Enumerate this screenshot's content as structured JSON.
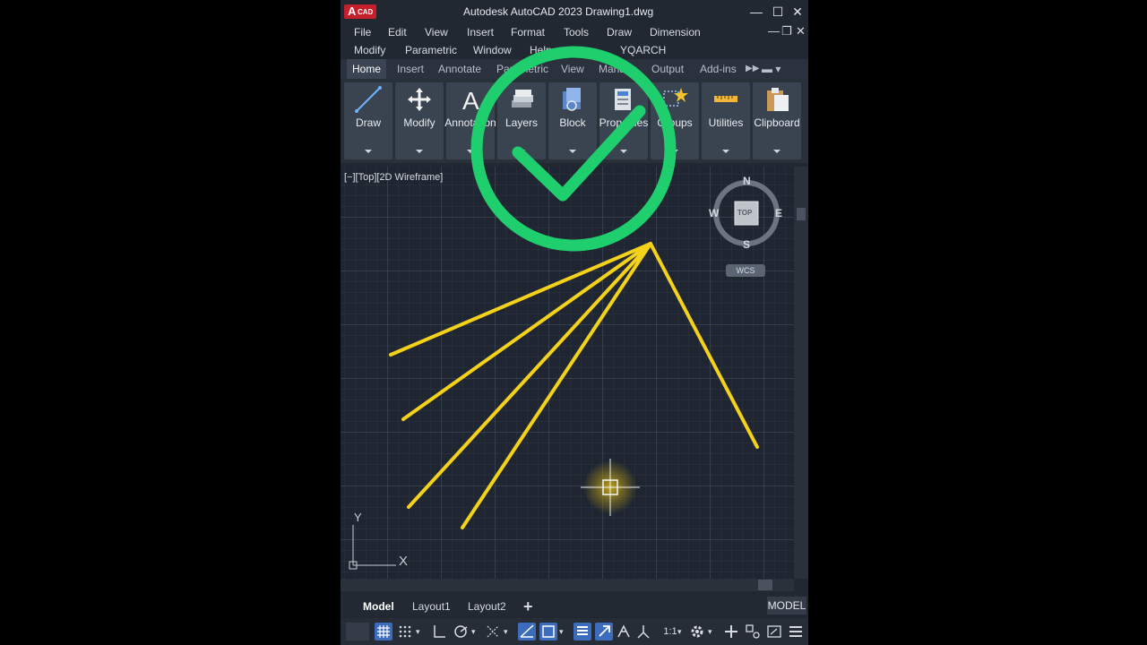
{
  "window": {
    "app_logo_text": "A",
    "app_logo_sub": "CAD",
    "title": "Autodesk AutoCAD 2023   Drawing1.dwg",
    "minimize_glyph": "—",
    "maximize_glyph": "☐",
    "close_glyph": "✕"
  },
  "menu": {
    "row1": [
      "File",
      "Edit",
      "View",
      "Insert",
      "Format",
      "Tools",
      "Draw",
      "Dimension"
    ],
    "row2": [
      "Modify",
      "Parametric",
      "Window",
      "Help",
      "YQARCH"
    ]
  },
  "ribbon_tabs": [
    "Home",
    "Insert",
    "Annotate",
    "Parametric",
    "View",
    "Manage",
    "Output",
    "Add-ins"
  ],
  "ribbon_panels": [
    "Draw",
    "Modify",
    "Annotation",
    "Layers",
    "Block",
    "Properties",
    "Groups",
    "Utilities",
    "Clipboard"
  ],
  "viewport": {
    "label": "[−][Top][2D Wireframe]",
    "compass": {
      "n": "N",
      "s": "S",
      "e": "E",
      "w": "W",
      "top": "TOP"
    },
    "wcs": "WCS",
    "ucs": {
      "x": "X",
      "y": "Y"
    }
  },
  "layout_tabs": [
    "Model",
    "Layout1",
    "Layout2"
  ],
  "add_layout": "+",
  "model_badge": "MODEL",
  "status_scale": "1:1",
  "colors": {
    "background": "#212832",
    "accent_green": "#1fcf6e",
    "line_yellow": "#f5d21a",
    "active_blue": "#3c6dbd",
    "logo_red": "#c51f2c"
  }
}
